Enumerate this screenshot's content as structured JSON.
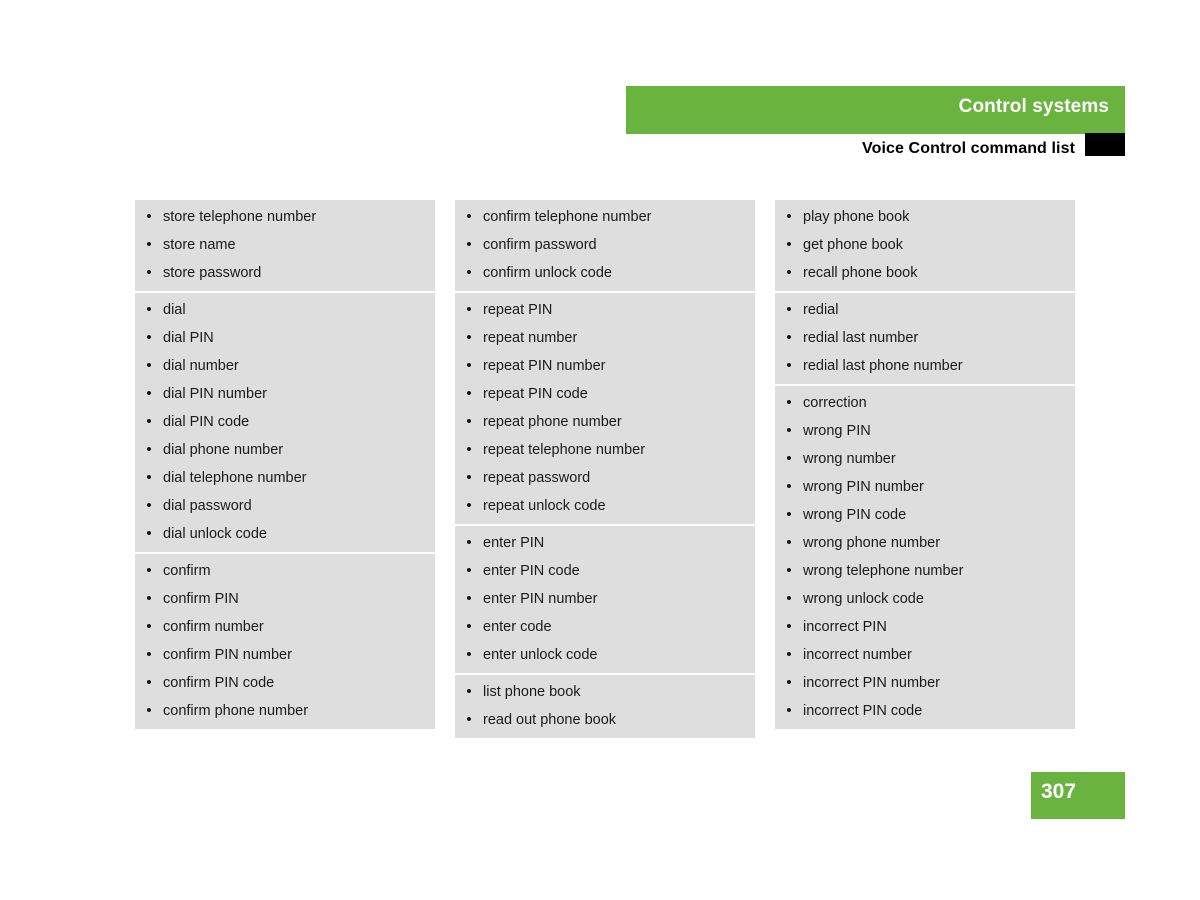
{
  "header": {
    "title": "Control systems",
    "subtitle": "Voice Control command list",
    "green_color": "#6BB33F",
    "marker_color": "#000000"
  },
  "page_footer": {
    "page_number": "307",
    "badge_color": "#6BB33F"
  },
  "list_style": {
    "bullet": "•",
    "box_color": "#DEDEDE",
    "separator_color": "#FFFFFF"
  },
  "columns": [
    {
      "name": "column-1",
      "groups": [
        {
          "items": [
            "store telephone number",
            "store name",
            "store password"
          ]
        },
        {
          "items": [
            "dial",
            "dial PIN",
            "dial number",
            "dial PIN number",
            "dial PIN code",
            "dial phone number",
            "dial telephone number",
            "dial password",
            "dial unlock code"
          ]
        },
        {
          "items": [
            "confirm",
            "confirm PIN",
            "confirm number",
            "confirm PIN number",
            "confirm PIN code",
            "confirm phone number"
          ]
        }
      ]
    },
    {
      "name": "column-2",
      "groups": [
        {
          "items": [
            "confirm telephone number",
            "confirm password",
            "confirm unlock code"
          ]
        },
        {
          "items": [
            "repeat PIN",
            "repeat number",
            "repeat PIN number",
            "repeat PIN code",
            "repeat phone number",
            "repeat telephone number",
            "repeat password",
            "repeat unlock code"
          ]
        },
        {
          "items": [
            "enter PIN",
            "enter PIN code",
            "enter PIN number",
            "enter code",
            "enter unlock code"
          ]
        },
        {
          "items": [
            "list phone book",
            "read out phone book"
          ]
        }
      ]
    },
    {
      "name": "column-3",
      "groups": [
        {
          "items": [
            "play phone book",
            "get phone book",
            "recall phone book"
          ]
        },
        {
          "items": [
            "redial",
            "redial last number",
            "redial last phone number"
          ]
        },
        {
          "items": [
            "correction",
            "wrong PIN",
            "wrong number",
            "wrong PIN number",
            "wrong PIN code",
            "wrong phone number",
            "wrong telephone number",
            "wrong unlock code",
            "incorrect PIN",
            "incorrect number",
            "incorrect PIN number",
            "incorrect PIN code"
          ]
        }
      ]
    }
  ]
}
